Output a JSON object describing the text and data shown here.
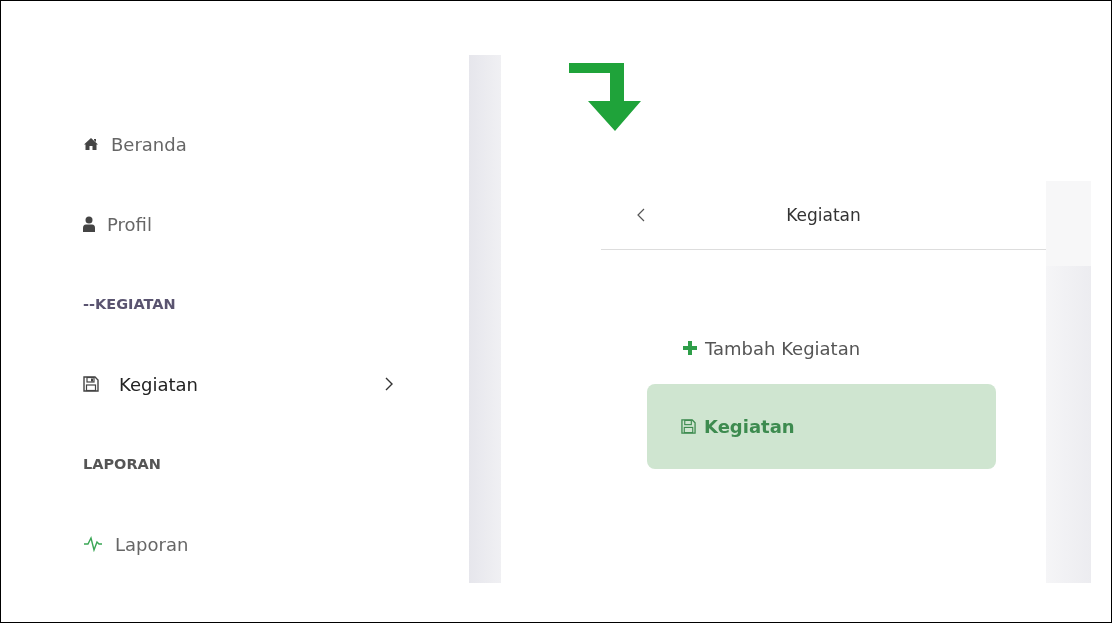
{
  "sidebar": {
    "items": [
      {
        "kind": "link",
        "label": "Beranda"
      },
      {
        "kind": "link",
        "label": "Profil"
      },
      {
        "kind": "header",
        "label": "--KEGIATAN"
      },
      {
        "kind": "submenu",
        "label": "Kegiatan"
      },
      {
        "kind": "header",
        "label": "LAPORAN"
      },
      {
        "kind": "link",
        "label": "Laporan"
      }
    ]
  },
  "submenu": {
    "title": "Kegiatan",
    "items": [
      {
        "label": "Tambah Kegiatan",
        "selected": false
      },
      {
        "label": "Kegiatan",
        "selected": true
      }
    ]
  }
}
